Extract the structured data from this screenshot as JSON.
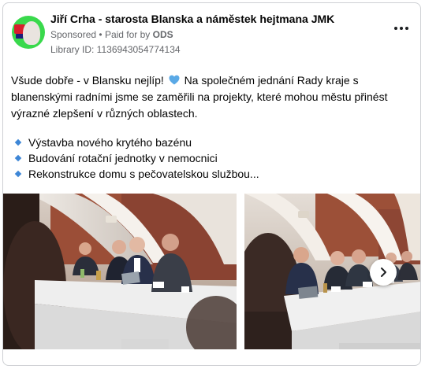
{
  "ad": {
    "page_name": "Jiří Crha - starosta Blanska a náměstek hejtmana JMK",
    "sponsored_label": "Sponsored",
    "separator": "•",
    "paid_for_label": "Paid for by",
    "paid_for_by": "ODS",
    "library_id": "Library ID: 1136943054774134",
    "more_options_icon": "more-horizontal-icon",
    "avatar_icon": "profile-avatar"
  },
  "body": {
    "line1_before_heart": "Všude dobře - v Blansku nejlíp!",
    "heart_icon": "blue-heart-icon",
    "heart_color": "#5aa9e6",
    "line1_after_heart": "Na společném jednání Rady kraje s blanenskými radními jsme se zaměřili na projekty, které mohou městu přinést výrazné zlepšení v různých oblastech.",
    "bullets": [
      "Výstavba nového krytého bazénu",
      "Budování rotační jednotky v nemocnici",
      "Rekonstrukce domu s pečovatelskou službou..."
    ],
    "bullet_icon": "small-blue-diamond-icon",
    "bullet_color": "#3d86d6"
  },
  "carousel": {
    "next_icon": "chevron-right-icon",
    "images": [
      "meeting-photo",
      "meeting-photo"
    ]
  },
  "colors": {
    "text": "#050505",
    "secondary": "#65676b",
    "border": "#ced0d4",
    "avatar_bg": "#39d94c"
  }
}
